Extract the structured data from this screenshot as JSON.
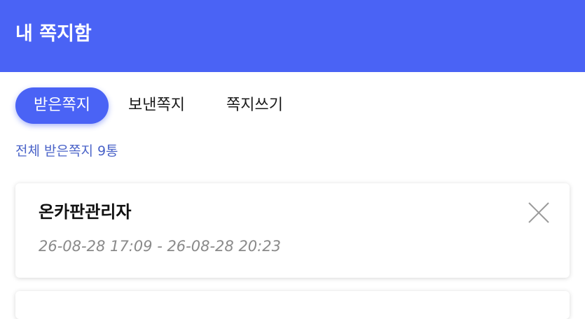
{
  "header": {
    "title": "내 쪽지함"
  },
  "tabs": [
    {
      "label": "받은쪽지",
      "active": true
    },
    {
      "label": "보낸쪽지",
      "active": false
    },
    {
      "label": "쪽지쓰기",
      "active": false
    }
  ],
  "summary": {
    "total_label": "전체 받은쪽지 9통"
  },
  "messages": [
    {
      "sender": "온카판관리자",
      "datetime": "26-08-28 17:09 - 26-08-28 20:23",
      "close_icon": "close-icon"
    }
  ],
  "colors": {
    "accent": "#4a63f5",
    "count_text": "#4a63c8",
    "date_text": "#8a8a8a"
  }
}
